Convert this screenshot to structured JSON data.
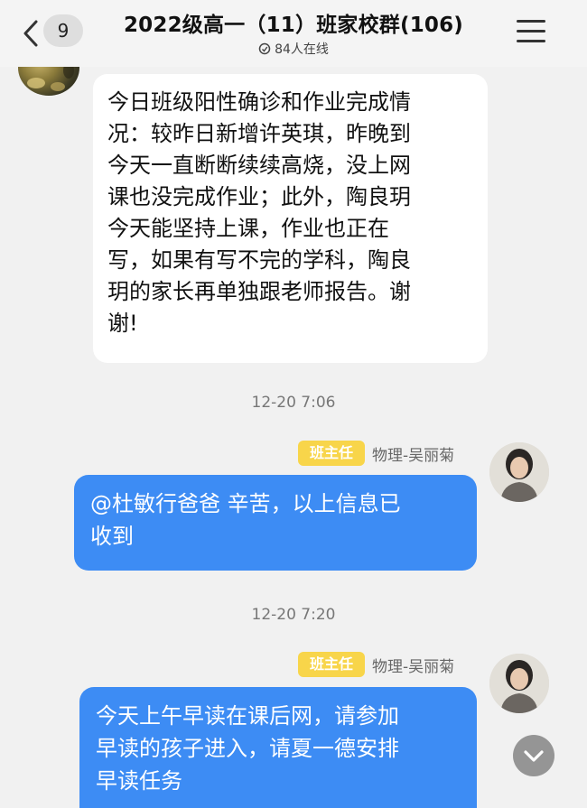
{
  "header": {
    "back_count": "9",
    "title": "2022级高一（11）班家校群(106)",
    "online_text": "84人在线"
  },
  "messages": [
    {
      "type": "incoming",
      "lines": [
        "今日班级阳性确诊和作业完成情",
        "况：较昨日新增许英琪，昨晚到",
        "今天一直断断续续高烧，没上网",
        "课也没完成作业；此外，陶良玥",
        "今天能坚持上课，作业也正在",
        "写，如果有写不完的学科，陶良",
        "玥的家长再单独跟老师报告。谢",
        "谢!"
      ]
    },
    {
      "time": "12-20 7:06",
      "role": "班主任",
      "sender": "物理-吴丽菊",
      "lines": [
        "@杜敏行爸爸 辛苦，以上信息已",
        "收到"
      ]
    },
    {
      "time": "12-20 7:20",
      "role": "班主任",
      "sender": "物理-吴丽菊",
      "lines": [
        "今天上午早读在课后网，请参加",
        "早读的孩子进入，请夏一德安排",
        "早读任务"
      ]
    }
  ],
  "colors": {
    "outgoing_bubble": "#3d8cf4",
    "role_tag": "#f8d54a",
    "background": "#f1f1f1"
  },
  "icons": {
    "back": "chevron-left-icon",
    "menu": "hamburger-menu-icon",
    "online": "clock-icon",
    "scroll": "chevron-down-icon"
  }
}
